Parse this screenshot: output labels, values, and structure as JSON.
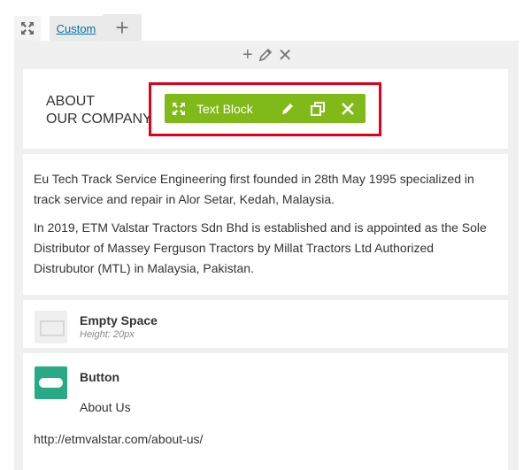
{
  "tabs": {
    "expand_icon": "expand-icon",
    "custom_label": "Custom",
    "add_icon": "plus-icon"
  },
  "column_controls": [
    "plus-icon",
    "pencil-icon",
    "close-icon"
  ],
  "about_block": {
    "title_line1": "ABOUT",
    "title_line2": "OUR COMPANY"
  },
  "element_controls": {
    "name": "Text Block",
    "icons": [
      "move-icon",
      "pencil-icon",
      "clone-icon",
      "close-icon"
    ],
    "color": "#7fba18",
    "highlight_color": "#e0001b"
  },
  "text_block": {
    "paragraph1": "Eu Tech Track Service Engineering first founded in 28th May 1995 specialized in track service and repair in Alor Setar, Kedah, Malaysia.",
    "paragraph2": "In 2019, ETM Valstar Tractors Sdn Bhd is established and is appointed as the Sole Distributor of Massey Ferguson Tractors by Millat Tractors Ltd Authorized Distrubutor (MTL) in Malaysia, Pakistan."
  },
  "empty_space": {
    "title": "Empty Space",
    "height_label": "Height: 20px"
  },
  "button_element": {
    "title": "Button",
    "label": "About Us",
    "url": "http://etmvalstar.com/about-us/",
    "icon_color": "#2aa986"
  }
}
